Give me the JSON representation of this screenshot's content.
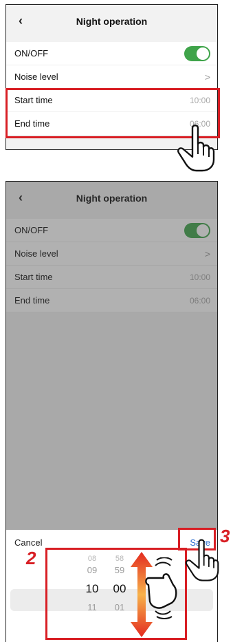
{
  "screen": {
    "title": "Night operation",
    "back_icon": "chevron-left-icon",
    "rows": [
      {
        "label": "ON/OFF",
        "value": "",
        "control": "toggle-on"
      },
      {
        "label": "Noise level",
        "value": ">",
        "control": "chevron"
      },
      {
        "label": "Start time",
        "value": "10:00",
        "control": "value"
      },
      {
        "label": "End time",
        "value": "06:00",
        "control": "value"
      }
    ]
  },
  "picker": {
    "cancel_label": "Cancel",
    "save_label": "Save",
    "hours": [
      "08",
      "09",
      "10",
      "11"
    ],
    "minutes": [
      "58",
      "59",
      "00",
      "01"
    ],
    "selected_hour": "10",
    "selected_minute": "00"
  },
  "annotations": {
    "step2": "2",
    "step3": "3"
  },
  "colors": {
    "accent_red": "#d81e24",
    "toggle_green": "#3fa44a",
    "save_blue": "#2e6fd0"
  }
}
